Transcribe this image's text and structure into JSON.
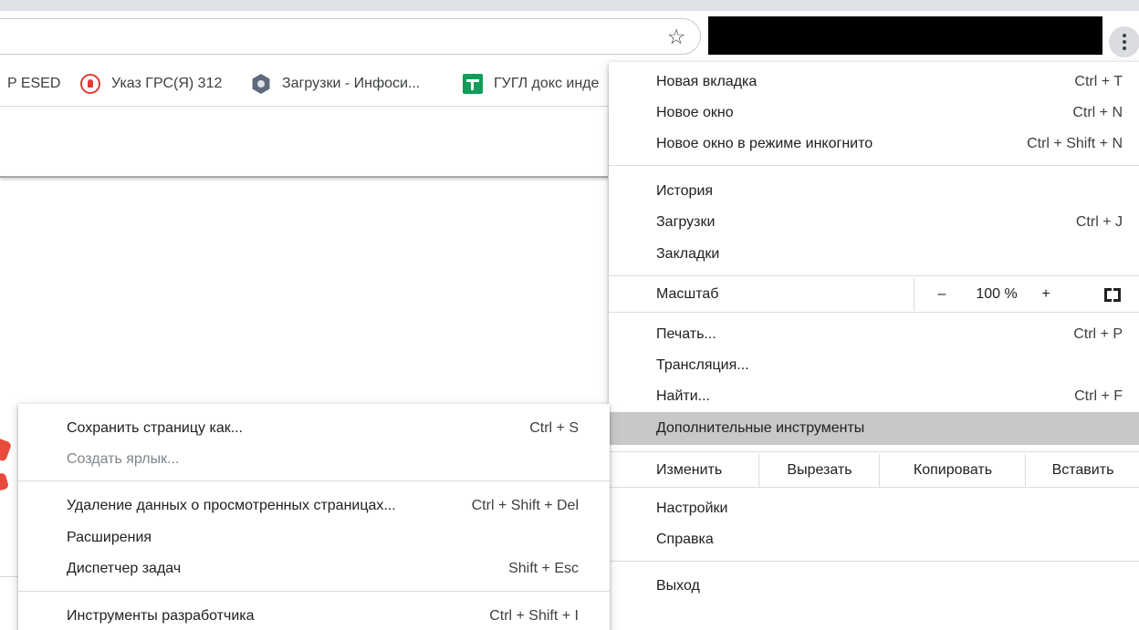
{
  "colors": {
    "menu_highlight": "#c8c8c8",
    "separator": "#dadce0",
    "disabled_text": "#80868b",
    "bookmark_sheet_green": "#0f9d58",
    "bookmark_fire_red": "#e53935"
  },
  "toolbar": {
    "bookmark_star_icon": "star-outline-icon",
    "star_glyph": "☆",
    "menu_icon": "three-dots-vertical-icon"
  },
  "bookmarks": [
    {
      "label": "P ESED",
      "icon": null
    },
    {
      "label": "Указ ГРС(Я) 312",
      "icon": "fire-logo-icon"
    },
    {
      "label": "Загрузки - Инфоси...",
      "icon": "hexagon-logo-icon"
    },
    {
      "label": "ГУГЛ докс инде",
      "icon": "google-sheets-icon"
    }
  ],
  "main_menu": {
    "new_tab": {
      "label": "Новая вкладка",
      "shortcut": "Ctrl + T"
    },
    "new_window": {
      "label": "Новое окно",
      "shortcut": "Ctrl + N"
    },
    "incognito": {
      "label": "Новое окно в режиме инкогнито",
      "shortcut": "Ctrl + Shift + N"
    },
    "history": {
      "label": "История"
    },
    "downloads": {
      "label": "Загрузки",
      "shortcut": "Ctrl + J"
    },
    "bookmarks": {
      "label": "Закладки"
    },
    "zoom": {
      "label": "Масштаб",
      "minus": "–",
      "value": "100 %",
      "plus": "+",
      "fullscreen_icon": "fullscreen-icon"
    },
    "print": {
      "label": "Печать...",
      "shortcut": "Ctrl + P"
    },
    "cast": {
      "label": "Трансляция..."
    },
    "find": {
      "label": "Найти...",
      "shortcut": "Ctrl + F"
    },
    "more_tools": {
      "label": "Дополнительные инструменты"
    },
    "edit": {
      "label": "Изменить",
      "cut": "Вырезать",
      "copy": "Копировать",
      "paste": "Вставить"
    },
    "settings": {
      "label": "Настройки"
    },
    "help": {
      "label": "Справка"
    },
    "exit": {
      "label": "Выход"
    }
  },
  "more_tools_menu": {
    "save_page": {
      "label": "Сохранить страницу как...",
      "shortcut": "Ctrl + S"
    },
    "create_shortcut": {
      "label": "Создать ярлык..."
    },
    "clear_data": {
      "label": "Удаление данных о просмотренных страницах...",
      "shortcut": "Ctrl + Shift + Del"
    },
    "extensions": {
      "label": "Расширения"
    },
    "task_manager": {
      "label": "Диспетчер задач",
      "shortcut": "Shift + Esc"
    },
    "dev_tools": {
      "label": "Инструменты разработчика",
      "shortcut": "Ctrl + Shift + I"
    }
  }
}
